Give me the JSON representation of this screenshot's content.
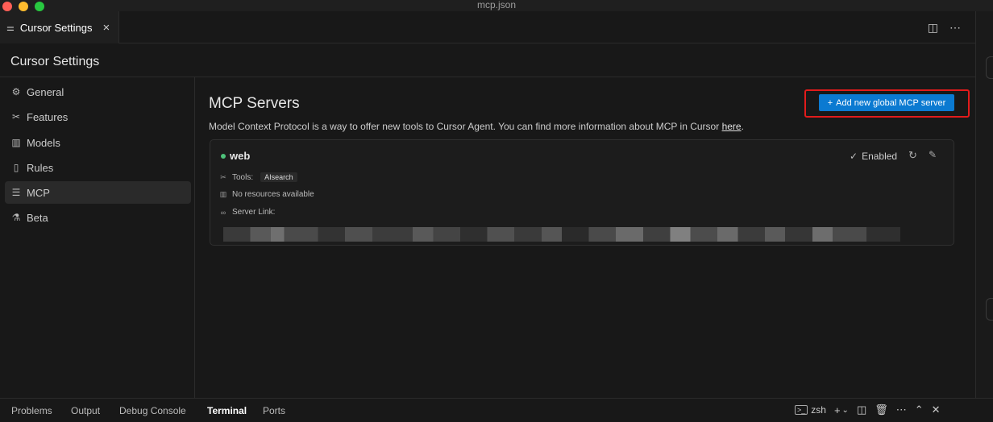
{
  "window": {
    "title": "mcp.json"
  },
  "tab": {
    "label": "Cursor Settings",
    "close": "×"
  },
  "settings": {
    "title": "Cursor Settings"
  },
  "sidebar": {
    "items": [
      {
        "label": "General",
        "icon": "gear-icon",
        "glyph": "⚙"
      },
      {
        "label": "Features",
        "icon": "tools-icon",
        "glyph": "✂"
      },
      {
        "label": "Models",
        "icon": "bar-chart-icon",
        "glyph": "▥"
      },
      {
        "label": "Rules",
        "icon": "document-icon",
        "glyph": "▯"
      },
      {
        "label": "MCP",
        "icon": "server-stack-icon",
        "glyph": "☰",
        "active": true
      },
      {
        "label": "Beta",
        "icon": "flask-icon",
        "glyph": "⚗"
      }
    ]
  },
  "main": {
    "title": "MCP Servers",
    "add_button": "Add new global MCP server",
    "add_button_glyph": "+",
    "description": "Model Context Protocol is a way to offer new tools to Cursor Agent. You can find more information about MCP in Cursor ",
    "description_link": "here",
    "description_end": "."
  },
  "server": {
    "name": "web",
    "status_color": "#4ec27a",
    "enabled_label": "Enabled",
    "tools_label": "Tools:",
    "tool_name": "AIsearch",
    "resources_label": "No resources available",
    "server_link_label": "Server Link:"
  },
  "panel": {
    "tabs": [
      "Problems",
      "Output",
      "Debug Console",
      "Terminal",
      "Ports"
    ],
    "active_tab": "Terminal",
    "shell": "zsh"
  },
  "colors": {
    "accent": "#0b7ad1",
    "highlight": "#e21b1b",
    "background": "#181818"
  }
}
